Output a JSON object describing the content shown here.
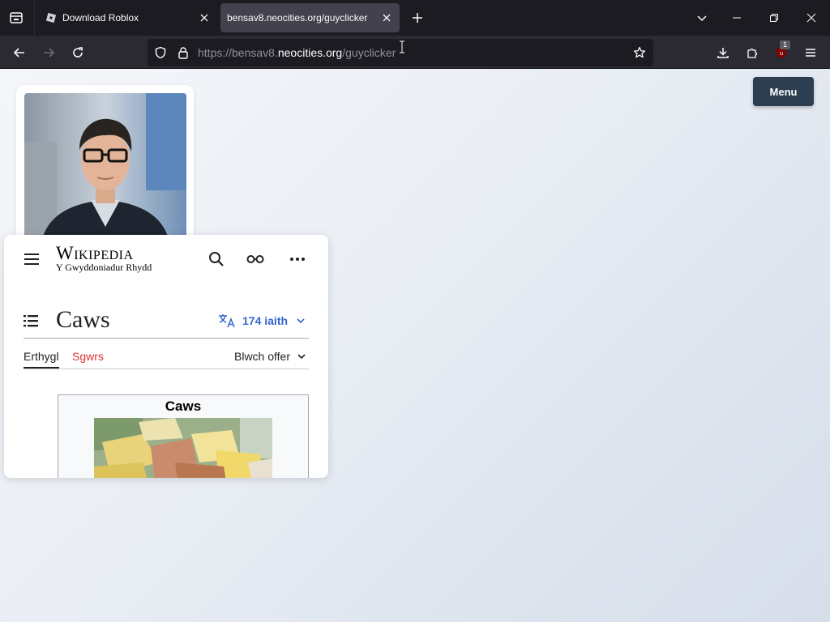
{
  "browser": {
    "tabs": [
      {
        "title": "Download Roblox",
        "active": false
      },
      {
        "title": "bensav8.neocities.org/guyclicker",
        "active": true
      }
    ],
    "url": {
      "prefix": "https://bensav8.",
      "host": "neocities.org",
      "path": "/guyclicker"
    },
    "extension_badge": "1",
    "colors": {
      "tabstrip": "#1c1b22",
      "navbar": "#2b2a33",
      "active_tab": "#42414d"
    }
  },
  "page": {
    "menu_label": "Menu",
    "wiki": {
      "wordmark": "Wikipedia",
      "tagline": "Y Gwyddoniadur Rhydd",
      "title": "Caws",
      "language_count": "174 iaith",
      "tab_article": "Erthygl",
      "tab_talk": "Sgwrs",
      "tools": "Blwch offer",
      "infobox_title": "Caws",
      "colors": {
        "link": "#3366cc",
        "talk_link": "#dd3333"
      }
    }
  }
}
